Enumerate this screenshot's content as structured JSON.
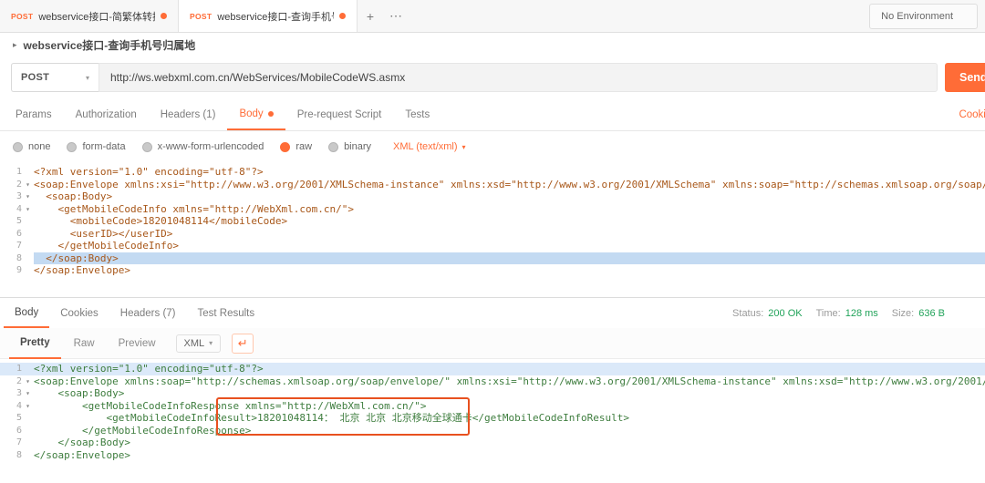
{
  "colors": {
    "accent": "#ff6c37",
    "status_green": "#21a35a",
    "annotation": "#e8511f"
  },
  "icons": {
    "chevron_down": "▾",
    "collapse_arrow": "▸",
    "fold_arrow": "▾",
    "wrap_icon": "↵",
    "new_tab": "+",
    "more_tabs": "⋯"
  },
  "topbar": {
    "tabs": [
      {
        "method": "POST",
        "label": "webservice接口-简繁体转换"
      },
      {
        "method": "POST",
        "label": "webservice接口-查询手机号归属"
      }
    ],
    "environment": "No Environment"
  },
  "request": {
    "title": "webservice接口-查询手机号归属地",
    "method": "POST",
    "url": "http://ws.webxml.com.cn/WebServices/MobileCodeWS.asmx",
    "send": "Send",
    "tabs": {
      "params": "Params",
      "auth": "Authorization",
      "headers": "Headers (1)",
      "body": "Body",
      "prerequest": "Pre-request Script",
      "tests": "Tests",
      "cookies": "Cookies"
    },
    "modes": [
      "none",
      "form-data",
      "x-www-form-urlencoded",
      "raw",
      "binary"
    ],
    "content_type": "XML (text/xml)",
    "body": [
      {
        "n": "1",
        "t": "<?xml version=\"1.0\" encoding=\"utf-8\"?>"
      },
      {
        "n": "2",
        "f": "▾",
        "t": "<soap:Envelope xmlns:xsi=\"http://www.w3.org/2001/XMLSchema-instance\" xmlns:xsd=\"http://www.w3.org/2001/XMLSchema\" xmlns:soap=\"http://schemas.xmlsoap.org/soap/envelope/\">"
      },
      {
        "n": "3",
        "f": "▾",
        "t": "  <soap:Body>"
      },
      {
        "n": "4",
        "f": "▾",
        "t": "    <getMobileCodeInfo xmlns=\"http://WebXml.com.cn/\">"
      },
      {
        "n": "5",
        "t": "      <mobileCode>18201048114</mobileCode>"
      },
      {
        "n": "6",
        "t": "      <userID></userID>"
      },
      {
        "n": "7",
        "t": "    </getMobileCodeInfo>"
      },
      {
        "n": "8",
        "t": "  </soap:Body>"
      },
      {
        "n": "9",
        "t": "</soap:Envelope>"
      }
    ]
  },
  "response": {
    "tabs": {
      "body": "Body",
      "cookies": "Cookies",
      "headers": "Headers (7)",
      "tests": "Test Results"
    },
    "status_label": "Status:",
    "status_value": "200 OK",
    "time_label": "Time:",
    "time_value": "128 ms",
    "size_label": "Size:",
    "size_value": "636 B",
    "views": {
      "pretty": "Pretty",
      "raw": "Raw",
      "preview": "Preview"
    },
    "format": "XML",
    "body": [
      {
        "n": "1",
        "t": "<?xml version=\"1.0\" encoding=\"utf-8\"?>"
      },
      {
        "n": "2",
        "f": "▾",
        "t": "<soap:Envelope xmlns:soap=\"http://schemas.xmlsoap.org/soap/envelope/\" xmlns:xsi=\"http://www.w3.org/2001/XMLSchema-instance\" xmlns:xsd=\"http://www.w3.org/2001/XMLSchema\">"
      },
      {
        "n": "3",
        "f": "▾",
        "t": "    <soap:Body>"
      },
      {
        "n": "4",
        "f": "▾",
        "t": "        <getMobileCodeInfoResponse xmlns=\"http://WebXml.com.cn/\">"
      },
      {
        "n": "5",
        "t": "            <getMobileCodeInfoResult>18201048114： 北京 北京 北京移动全球通卡</getMobileCodeInfoResult>"
      },
      {
        "n": "6",
        "t": "        </getMobileCodeInfoResponse>"
      },
      {
        "n": "7",
        "t": "    </soap:Body>"
      },
      {
        "n": "8",
        "t": "</soap:Envelope>"
      }
    ]
  }
}
